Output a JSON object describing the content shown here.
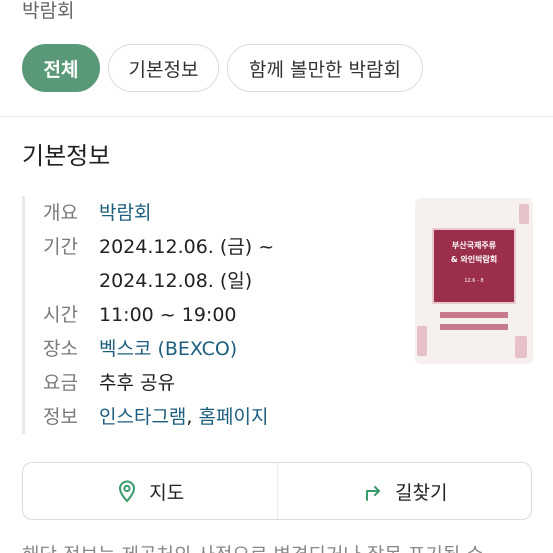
{
  "category": "박람회",
  "tabs": [
    {
      "label": "전체",
      "active": true
    },
    {
      "label": "기본정보",
      "active": false
    },
    {
      "label": "함께 볼만한 박람회",
      "active": false
    }
  ],
  "section_title": "기본정보",
  "info": {
    "overview": {
      "key": "개요",
      "value": "박람회"
    },
    "period": {
      "key": "기간",
      "line1": "2024.12.06. (금) ~",
      "line2": "2024.12.08. (일)"
    },
    "time": {
      "key": "시간",
      "value": "11:00 ~ 19:00"
    },
    "place": {
      "key": "장소",
      "value": "벡스코 (BEXCO)"
    },
    "fee": {
      "key": "요금",
      "value": "추후 공유"
    },
    "links": {
      "key": "정보",
      "instagram": "인스타그램",
      "sep": ", ",
      "homepage": "홈페이지"
    }
  },
  "poster": {
    "title_line1": "부산국제주류",
    "title_line2": "& 와인박람회",
    "date": "12.6 - 8"
  },
  "actions": {
    "map_label": "지도",
    "directions_label": "길찾기"
  },
  "footnote": "해당 정보는 제공처의 사정으로 변경되거나 잘못 표기될 수"
}
